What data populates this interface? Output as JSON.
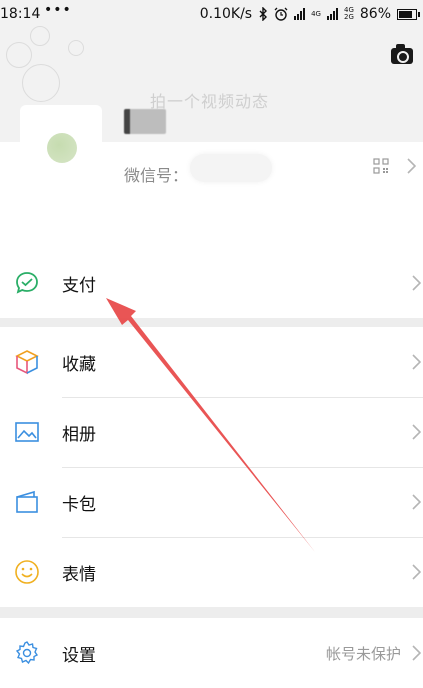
{
  "status_bar": {
    "time": "18:14",
    "dots": "•••",
    "network_speed": "0.10K/s",
    "battery_percent": "86%",
    "signal_labels": [
      "4G",
      "4G",
      "2G"
    ]
  },
  "header": {
    "post_hint": "拍一个视频动态",
    "wechat_id_label": "微信号："
  },
  "menu": {
    "pay": "支付",
    "favorites": "收藏",
    "album": "相册",
    "cards": "卡包",
    "stickers": "表情",
    "settings": "设置",
    "settings_extra": "帐号未保护"
  },
  "colors": {
    "background": "#ededed",
    "accent_green": "#07c160",
    "arrow_red": "#e84c4c"
  },
  "icons": {
    "camera": "camera-icon",
    "qr": "qr-code-icon",
    "pay": "pay-check-icon",
    "favorites": "cube-icon",
    "album": "picture-icon",
    "cards": "wallet-icon",
    "stickers": "smile-icon",
    "settings": "gear-icon"
  }
}
